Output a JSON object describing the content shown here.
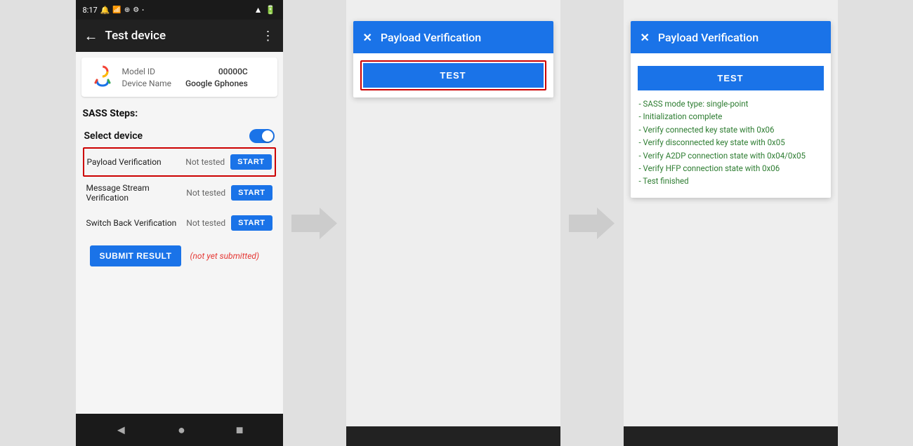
{
  "phone": {
    "status_bar": {
      "time": "8:17",
      "icons_left": [
        "notification",
        "sim",
        "location",
        "settings",
        "dot"
      ],
      "icons_right": [
        "wifi",
        "battery"
      ]
    },
    "toolbar": {
      "back_label": "←",
      "title": "Test device",
      "more_label": "⋮"
    },
    "device": {
      "model_id_label": "Model ID",
      "model_id_value": "00000C",
      "device_name_label": "Device Name",
      "device_name_value": "Google Gphones"
    },
    "sass_title": "SASS Steps:",
    "select_device_label": "Select device",
    "steps": [
      {
        "name": "Payload Verification",
        "status": "Not tested",
        "button": "START",
        "highlighted": true
      },
      {
        "name": "Message Stream\nVerification",
        "status": "Not tested",
        "button": "START",
        "highlighted": false
      },
      {
        "name": "Switch Back Verification",
        "status": "Not tested",
        "button": "START",
        "highlighted": false
      }
    ],
    "submit_btn": "SUBMIT RESULT",
    "submit_status": "(not yet submitted)",
    "nav": [
      "◄",
      "●",
      "■"
    ]
  },
  "dialog1": {
    "close": "✕",
    "title": "Payload Verification",
    "test_btn": "TEST",
    "has_red_border": true
  },
  "dialog2": {
    "close": "✕",
    "title": "Payload Verification",
    "test_btn": "TEST",
    "log_lines": [
      "- SASS mode type: single-point",
      "- Initialization complete",
      "- Verify connected key state with 0x06",
      "- Verify disconnected key state with 0x05",
      "- Verify A2DP connection state with 0x04/0x05",
      "- Verify HFP connection state with 0x06",
      "- Test finished"
    ]
  }
}
